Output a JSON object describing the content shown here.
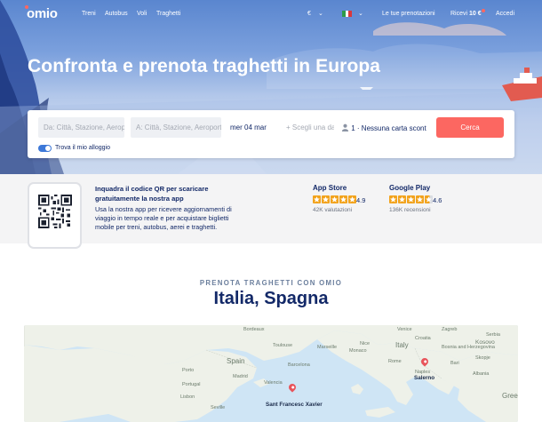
{
  "nav": {
    "logo": "omio",
    "links": [
      "Treni",
      "Autobus",
      "Voli",
      "Traghetti"
    ],
    "currency": "€",
    "my_bookings": "Le tue prenotazioni",
    "receive_prefix": "Ricevi",
    "receive_amount": "10 €",
    "login": "Accedi"
  },
  "hero": {
    "title": "Confronta e prenota traghetti in Europa"
  },
  "search": {
    "from_placeholder": "Da: Città, Stazione, Aeroporto",
    "to_placeholder": "A: Città, Stazione, Aeroporto",
    "date_value": "mer 04 mar",
    "return_placeholder": "+ Scegli una data",
    "passengers": "1 · Nessuna carta sconto",
    "button": "Cerca",
    "toggle_label": "Trova il mio alloggio"
  },
  "promo": {
    "title": "Inquadra il codice QR per scaricare gratuitamente la nostra app",
    "text": "Usa la nostra app per ricevere aggiornamenti di viaggio in tempo reale e per acquistare biglietti mobile per treni, autobus, aerei e traghetti."
  },
  "stores": [
    {
      "name": "App Store",
      "rating": "4.9",
      "reviews": "42K valutazioni",
      "stars": 5
    },
    {
      "name": "Google Play",
      "rating": "4.6",
      "reviews": "136K recensioni",
      "stars": 4.6
    }
  ],
  "section": {
    "eyebrow": "PRENOTA TRAGHETTI CON OMIO",
    "title": "Italia, Spagna"
  },
  "map": {
    "labels": {
      "bordeaux": "Bordeaux",
      "toulouse": "Toulouse",
      "marseille": "Marseille",
      "nice": "Nice",
      "monaco": "Monaco",
      "venice": "Venice",
      "zagreb": "Zagreb",
      "croatia": "Croatia",
      "bosnia": "Bosnia and Herzegovina",
      "serbia": "Serbia",
      "kosovo": "Kosovo",
      "skopje": "Skopje",
      "spain": "Spain",
      "italy": "Italy",
      "porto": "Porto",
      "portugal": "Portugal",
      "madrid": "Madrid",
      "barcelona": "Barcelona",
      "lisbon": "Lisbon",
      "seville": "Seville",
      "valencia": "Valencia",
      "rome": "Rome",
      "naples": "Naples",
      "bari": "Bari",
      "albania": "Albania",
      "greece": "Greece"
    },
    "pins": [
      {
        "name": "Salerno"
      },
      {
        "name": "Sant Francesc Xavier"
      }
    ]
  }
}
